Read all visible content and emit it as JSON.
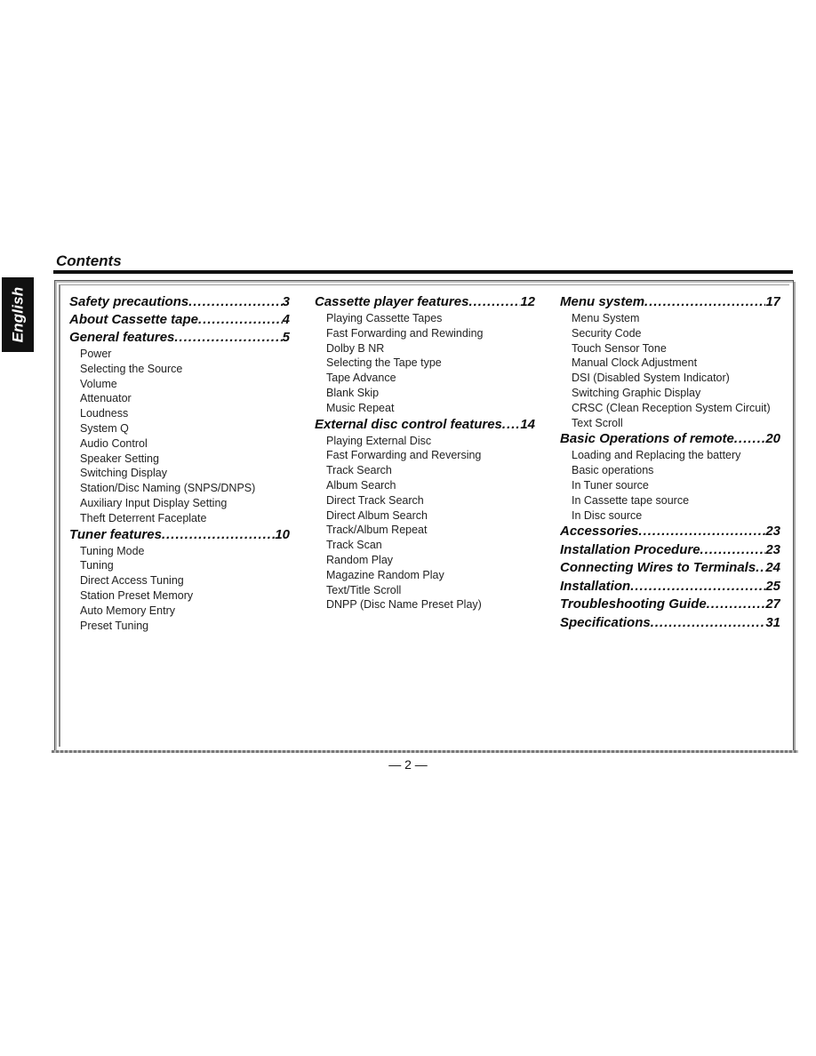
{
  "language_tab": "English",
  "page_title": "Contents",
  "columns": [
    {
      "sections": [
        {
          "title": "Safety precautions",
          "page": "3",
          "items": []
        },
        {
          "title": "About Cassette tape",
          "page": "4",
          "items": []
        },
        {
          "title": "General features",
          "page": "5",
          "items": [
            "Power",
            "Selecting the Source",
            "Volume",
            "Attenuator",
            "Loudness",
            "System Q",
            "Audio Control",
            "Speaker Setting",
            "Switching Display",
            "Station/Disc Naming (SNPS/DNPS)",
            "Auxiliary Input Display Setting",
            "Theft Deterrent Faceplate"
          ]
        },
        {
          "title": "Tuner features",
          "page": "10",
          "items": [
            "Tuning Mode",
            "Tuning",
            "Direct Access Tuning",
            "Station Preset Memory",
            "Auto Memory Entry",
            "Preset Tuning"
          ]
        }
      ]
    },
    {
      "sections": [
        {
          "title": "Cassette player features",
          "page": "12",
          "items": [
            "Playing Cassette Tapes",
            "Fast Forwarding and Rewinding",
            "Dolby B NR",
            "Selecting the Tape type",
            "Tape Advance",
            "Blank Skip",
            "Music Repeat"
          ]
        },
        {
          "title": "External disc control features",
          "page": "14",
          "items": [
            "Playing External Disc",
            "Fast Forwarding and Reversing",
            "Track Search",
            "Album Search",
            "Direct Track Search",
            "Direct Album Search",
            "Track/Album Repeat",
            "Track Scan",
            "Random Play",
            "Magazine Random Play",
            "Text/Title Scroll",
            "DNPP (Disc Name Preset Play)"
          ]
        }
      ]
    },
    {
      "sections": [
        {
          "title": "Menu system",
          "page": "17",
          "items": [
            "Menu System",
            "Security Code",
            "Touch Sensor Tone",
            "Manual Clock Adjustment",
            "DSI (Disabled System Indicator)",
            "Switching Graphic Display",
            "CRSC (Clean Reception System Circuit)",
            "Text Scroll"
          ]
        },
        {
          "title": "Basic Operations of remote",
          "page": "20",
          "items": [
            "Loading and Replacing the battery",
            "Basic operations",
            "In Tuner source",
            "In Cassette tape source",
            "In Disc source"
          ]
        },
        {
          "title": "Accessories",
          "page": "23",
          "items": []
        },
        {
          "title": "Installation Procedure",
          "page": "23",
          "items": []
        },
        {
          "title": "Connecting Wires to Terminals",
          "page": "24",
          "items": []
        },
        {
          "title": "Installation",
          "page": "25",
          "items": []
        },
        {
          "title": "Troubleshooting Guide",
          "page": "27",
          "items": []
        },
        {
          "title": "Specifications",
          "page": "31",
          "items": []
        }
      ]
    }
  ],
  "page_number": "— 2 —"
}
